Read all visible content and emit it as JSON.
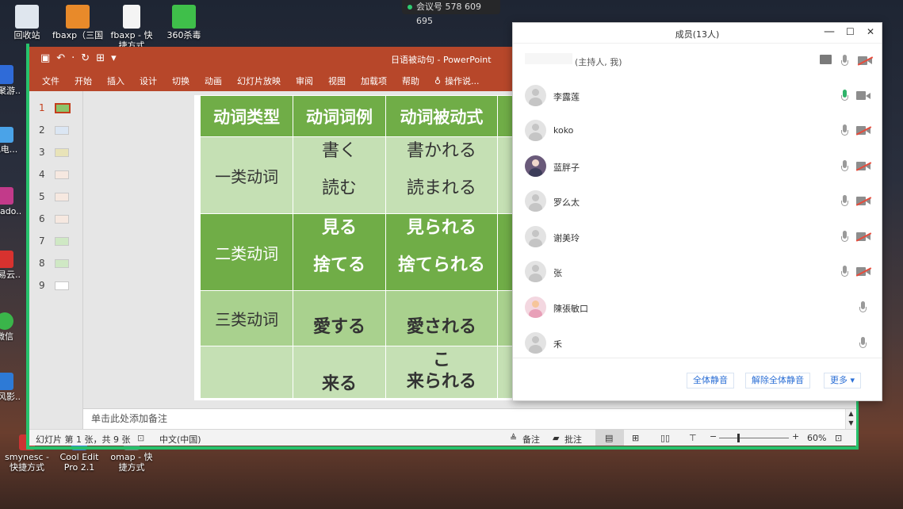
{
  "meeting": {
    "label": "会议号 578 609 695"
  },
  "desktop_icons": [
    {
      "label": "回收站"
    },
    {
      "label": "fbaxp（三国 ..."
    },
    {
      "label": "fbaxp - 快捷方式"
    },
    {
      "label": "360杀毒"
    },
    {
      "label": "游聚游..."
    },
    {
      "label": "此电..."
    },
    {
      "label": "Shado..."
    },
    {
      "label": "网易云..."
    },
    {
      "label": "微信"
    },
    {
      "label": "暴风影..."
    },
    {
      "label": "smynesc - 快捷方式"
    },
    {
      "label": "Cool Edit Pro 2.1"
    },
    {
      "label": "omap - 快捷方式"
    }
  ],
  "ppt": {
    "window_title": "日语被动句 - PowerPoint",
    "ribbon": [
      "文件",
      "开始",
      "插入",
      "设计",
      "切换",
      "动画",
      "幻灯片放映",
      "审阅",
      "视图",
      "加载项",
      "帮助",
      "操作说..."
    ],
    "slide_numbers": [
      "1",
      "2",
      "3",
      "4",
      "5",
      "6",
      "7",
      "8",
      "9"
    ],
    "table": {
      "headers": [
        "动词类型",
        "动词词例",
        "动词被动式"
      ],
      "rows": [
        {
          "type": "一类动词",
          "example1": "書く",
          "example2": "読む",
          "passive1": "書かれる",
          "passive2": "読まれる"
        },
        {
          "type": "二类动词",
          "example1": "見る",
          "example2": "捨てる",
          "passive1": "見られる",
          "passive2": "捨てられる"
        },
        {
          "type": "三类动词",
          "example1": "愛する",
          "passive1": "愛される"
        },
        {
          "type": "",
          "example1": "来る",
          "passive_top": "こ",
          "passive1": "来られる"
        }
      ]
    },
    "notes_placeholder": "单击此处添加备注",
    "status": {
      "slide_info": "幻灯片 第 1 张，共 9 张",
      "language": "中文(中国)",
      "notes": "备注",
      "comments": "批注",
      "zoom_minus": "−",
      "zoom_plus": "+",
      "zoom": "60%"
    }
  },
  "panel": {
    "title": "成员(13人)",
    "host_suffix": "(主持人, 我)",
    "members": [
      {
        "name": "李露莲",
        "mic": "on",
        "cam": "on"
      },
      {
        "name": "koko",
        "mic": "off",
        "cam": "off"
      },
      {
        "name": "蓝胖子",
        "mic": "off",
        "cam": "off"
      },
      {
        "name": "罗么太",
        "mic": "off",
        "cam": "off"
      },
      {
        "name": "谢美玲",
        "mic": "off",
        "cam": "off"
      },
      {
        "name": "张",
        "mic": "off",
        "cam": "off"
      },
      {
        "name": "陳張敏口",
        "mic": "off"
      },
      {
        "name": "禾",
        "mic": "off"
      }
    ],
    "buttons": {
      "mute_all": "全体静音",
      "unmute_all": "解除全体静音",
      "more": "更多 ▾"
    },
    "window_controls": {
      "minimize": "—",
      "maximize": "☐",
      "close": "✕"
    }
  }
}
